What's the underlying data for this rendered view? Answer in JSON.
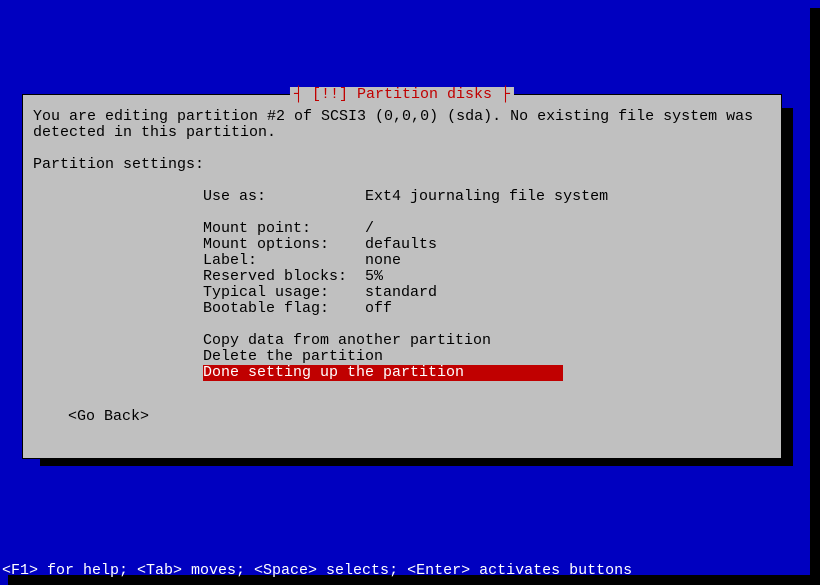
{
  "dialog": {
    "title": "┤ [!!] Partition disks ├",
    "intro": "You are editing partition #2 of SCSI3 (0,0,0) (sda). No existing file system was detected in this partition.",
    "section_label": "Partition settings:",
    "settings": [
      {
        "label": "Use as:",
        "value": "Ext4 journaling file system"
      },
      {
        "label": "",
        "value": ""
      },
      {
        "label": "Mount point:",
        "value": "/"
      },
      {
        "label": "Mount options:",
        "value": "defaults"
      },
      {
        "label": "Label:",
        "value": "none"
      },
      {
        "label": "Reserved blocks:",
        "value": "5%"
      },
      {
        "label": "Typical usage:",
        "value": "standard"
      },
      {
        "label": "Bootable flag:",
        "value": "off"
      }
    ],
    "actions": {
      "copy": "Copy data from another partition",
      "delete": "Delete the partition",
      "done": "Done setting up the partition"
    },
    "go_back": "<Go Back>"
  },
  "help_bar": "<F1> for help; <Tab> moves; <Space> selects; <Enter> activates buttons"
}
